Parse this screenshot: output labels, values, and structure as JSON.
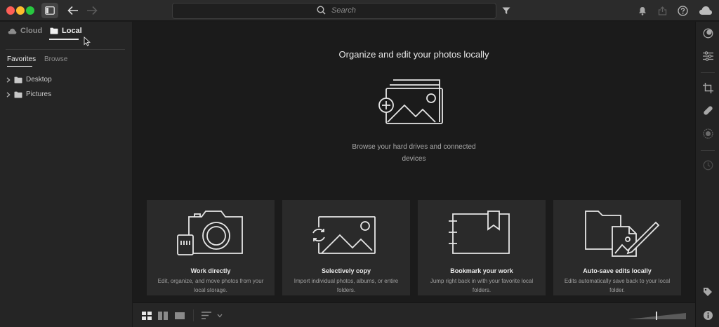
{
  "search": {
    "placeholder": "Search"
  },
  "sources": {
    "cloud_label": "Cloud",
    "local_label": "Local"
  },
  "browser_tabs": {
    "favorites": "Favorites",
    "browse": "Browse"
  },
  "favorites": [
    {
      "label": "Desktop"
    },
    {
      "label": "Pictures"
    }
  ],
  "main": {
    "heading": "Organize and edit your photos locally",
    "subtext": "Browse your hard drives and connected devices"
  },
  "cards": [
    {
      "title": "Work directly",
      "description": "Edit, organize, and move photos from your local storage."
    },
    {
      "title": "Selectively copy",
      "description": "Import individual photos, albums, or entire folders."
    },
    {
      "title": "Bookmark your work",
      "description": "Jump right back in with your favorite local folders."
    },
    {
      "title": "Auto-save edits locally",
      "description": "Edits automatically save back to your local folder."
    }
  ],
  "colors": {
    "background": "#1b1b1b",
    "panel": "#252525",
    "card": "#2a2a2a",
    "text": "#e8e8e8",
    "muted": "#a0a0a0"
  }
}
